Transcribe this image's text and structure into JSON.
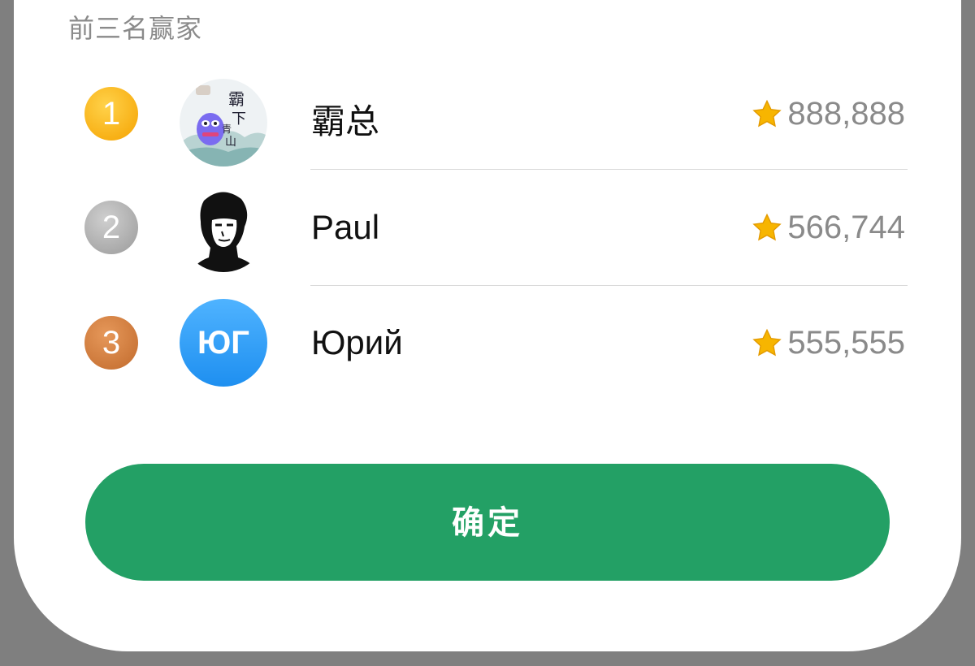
{
  "section": {
    "title": "前三名赢家"
  },
  "winners": [
    {
      "rank": "1",
      "name": "霸总",
      "score": "888,888",
      "avatar": {
        "type": "image",
        "icon": "avatar-frog-calligraphy"
      }
    },
    {
      "rank": "2",
      "name": "Paul",
      "score": "566,744",
      "avatar": {
        "type": "image",
        "icon": "avatar-silhouette-portrait"
      }
    },
    {
      "rank": "3",
      "name": "Юрий",
      "score": "555,555",
      "avatar": {
        "type": "initials",
        "initials": "ЮГ"
      }
    }
  ],
  "confirm": {
    "label": "确定"
  },
  "colors": {
    "accent": "#23a065",
    "gold": "#f5a200",
    "silver": "#9a9a9a",
    "bronze": "#c16a2c",
    "avatar_blue": "#1e8ff0",
    "score_text": "#8a8a8a"
  }
}
